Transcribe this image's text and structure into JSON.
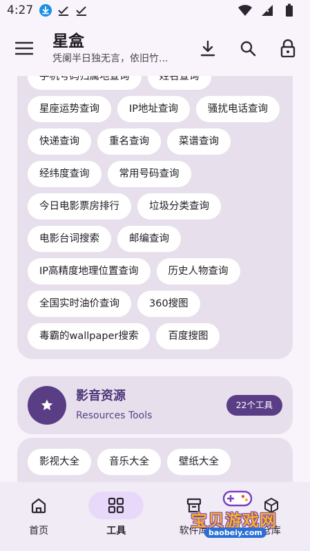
{
  "status_bar": {
    "time": "4:27"
  },
  "app_bar": {
    "title": "星盒",
    "subtitle": "凭阑半日独无言，依旧竹..."
  },
  "top_card": {
    "chips": [
      "手机号码归属地查询",
      "姓名查询",
      "星座运势查询",
      "IP地址查询",
      "骚扰电话查询",
      "快递查询",
      "重名查询",
      "菜谱查询",
      "经纬度查询",
      "常用号码查询",
      "今日电影票房排行",
      "垃圾分类查询",
      "电影台词搜索",
      "邮编查询",
      "IP高精度地理位置查询",
      "历史人物查询",
      "全国实时油价查询",
      "360搜图",
      "毒霸的wallpaper搜索",
      "百度搜图"
    ]
  },
  "section": {
    "title": "影音资源",
    "subtitle": "Resources Tools",
    "count": "22个工具",
    "icon": "star-icon",
    "accent": "#5a3e85"
  },
  "bottom_card": {
    "chips": [
      "影视大全",
      "音乐大全",
      "壁纸大全"
    ]
  },
  "bottom_nav": {
    "items": [
      {
        "label": "首页",
        "icon": "home-icon"
      },
      {
        "label": "工具",
        "icon": "grid-icon"
      },
      {
        "label": "软件库",
        "icon": "box-icon"
      },
      {
        "label": "仓库",
        "icon": "cube-icon"
      }
    ]
  },
  "watermark": {
    "text": "宝贝游戏网",
    "url": "baobeiy.com"
  }
}
